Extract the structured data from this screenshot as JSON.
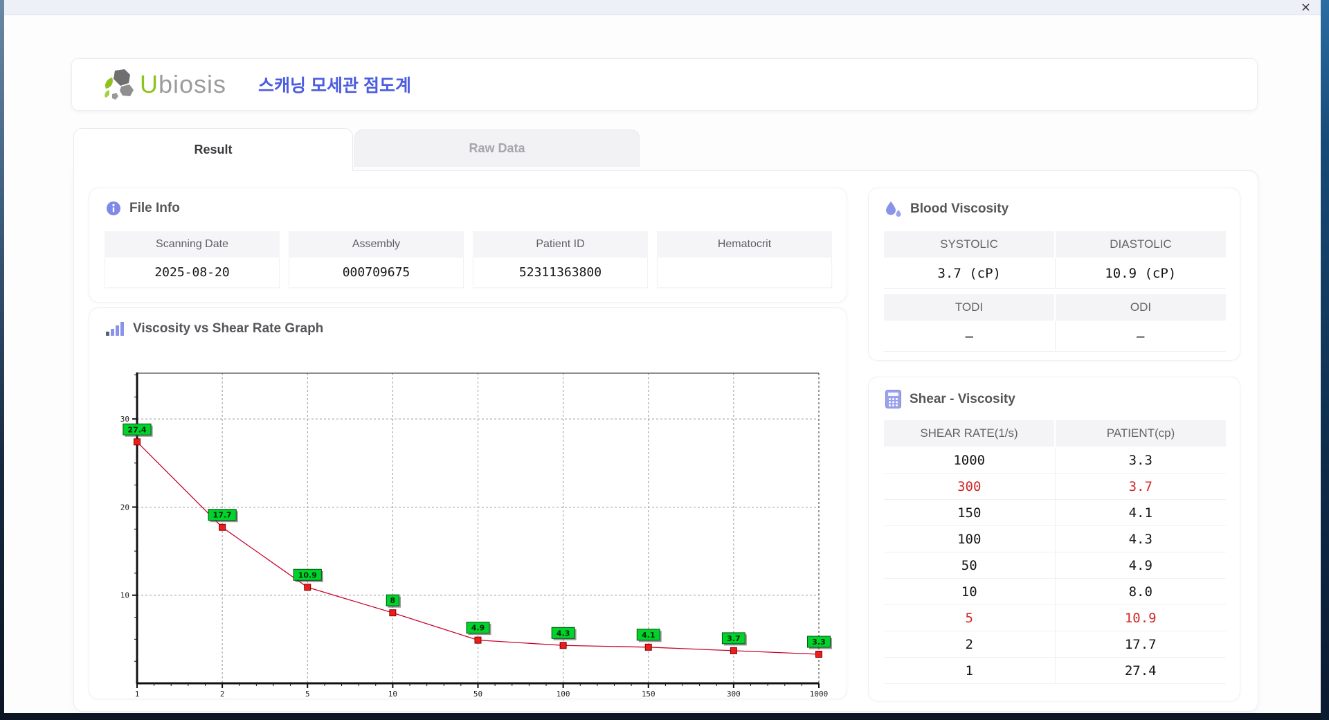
{
  "window": {
    "titlebar": {
      "close_label": "×"
    }
  },
  "header": {
    "logo_text_u": "U",
    "logo_text_rest": "biosis",
    "app_title": "스캐닝 모세관 점도계"
  },
  "tabs": [
    {
      "label": "Result",
      "active": true
    },
    {
      "label": "Raw Data",
      "active": false
    }
  ],
  "file_info": {
    "title": "File Info",
    "fields": [
      {
        "label": "Scanning Date",
        "value": "2025-08-20"
      },
      {
        "label": "Assembly",
        "value": "000709675"
      },
      {
        "label": "Patient ID",
        "value": "52311363800"
      },
      {
        "label": "Hematocrit",
        "value": ""
      }
    ]
  },
  "blood_viscosity": {
    "title": "Blood Viscosity",
    "rows": [
      {
        "headers": [
          "SYSTOLIC",
          "DIASTOLIC"
        ],
        "values": [
          "3.7 (cP)",
          "10.9 (cP)"
        ]
      },
      {
        "headers": [
          "TODI",
          "ODI"
        ],
        "values": [
          "–",
          "–"
        ]
      }
    ]
  },
  "chart_data": {
    "type": "line",
    "title": "Viscosity vs Shear Rate Graph",
    "x_mode": "categorical-evenly-spaced",
    "categories": [
      "1",
      "2",
      "5",
      "10",
      "50",
      "100",
      "150",
      "300",
      "1000"
    ],
    "values": [
      27.4,
      17.7,
      10.9,
      8,
      4.9,
      4.3,
      4.1,
      3.7,
      3.3
    ],
    "point_labels": [
      "27.4",
      "17.7",
      "10.9",
      "8",
      "4.9",
      "4.3",
      "4.1",
      "3.7",
      "3.3"
    ],
    "xlabel": "",
    "ylabel": "",
    "y_ticks": [
      10,
      20,
      30
    ],
    "ylim": [
      0,
      35.2
    ],
    "grid": "dashed",
    "legend": "none",
    "line_color": "#c9062c",
    "marker_color": "#ee1c1c",
    "point_label_bg": "#00d32a"
  },
  "shear_viscosity": {
    "title": "Shear - Viscosity",
    "columns": [
      "SHEAR RATE(1/s)",
      "PATIENT(cp)"
    ],
    "rows": [
      {
        "rate": "1000",
        "patient": "3.3",
        "highlight": false
      },
      {
        "rate": "300",
        "patient": "3.7",
        "highlight": true
      },
      {
        "rate": "150",
        "patient": "4.1",
        "highlight": false
      },
      {
        "rate": "100",
        "patient": "4.3",
        "highlight": false
      },
      {
        "rate": "50",
        "patient": "4.9",
        "highlight": false
      },
      {
        "rate": "10",
        "patient": "8.0",
        "highlight": false
      },
      {
        "rate": "5",
        "patient": "10.9",
        "highlight": true
      },
      {
        "rate": "2",
        "patient": "17.7",
        "highlight": false
      },
      {
        "rate": "1",
        "patient": "27.4",
        "highlight": false
      }
    ]
  },
  "colors": {
    "accent_purple": "#828ce8",
    "title_blue": "#4b5ce0",
    "logo_green": "#8dc21f",
    "highlight_red": "#d02828"
  }
}
